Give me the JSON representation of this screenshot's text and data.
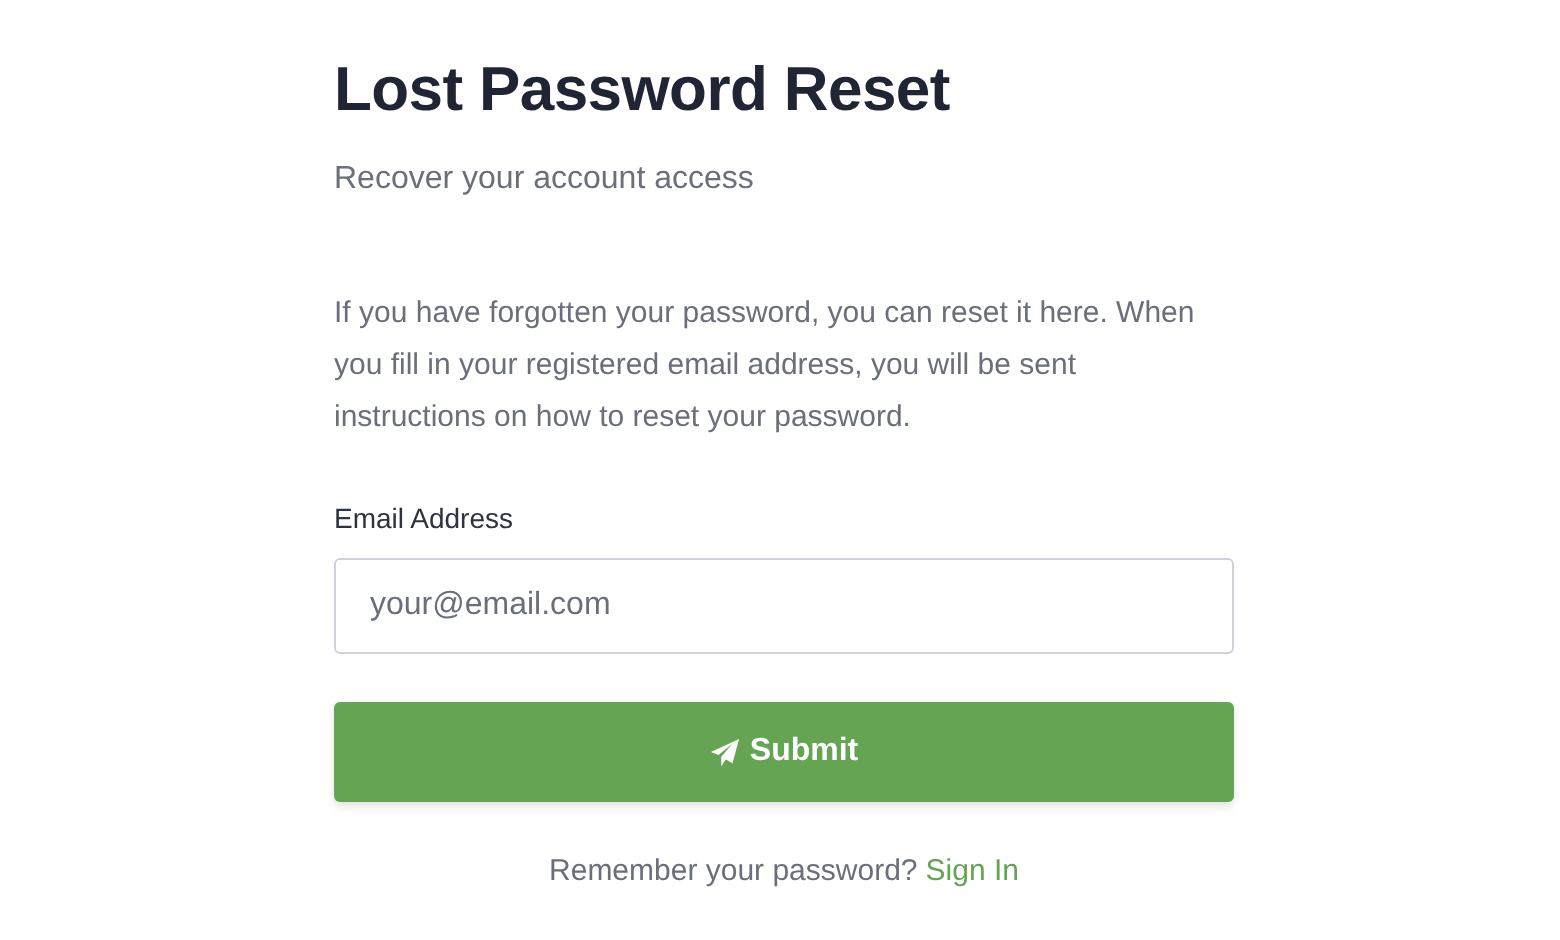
{
  "title": "Lost Password Reset",
  "subtitle": "Recover your account access",
  "description": "If you have forgotten your password, you can reset it here. When you fill in your registered email address, you will be sent instructions on how to reset your password.",
  "email_field": {
    "label": "Email Address",
    "placeholder": "your@email.com"
  },
  "submit_button": {
    "label": "Submit"
  },
  "footer": {
    "text": "Remember your password?",
    "link": "Sign In"
  }
}
